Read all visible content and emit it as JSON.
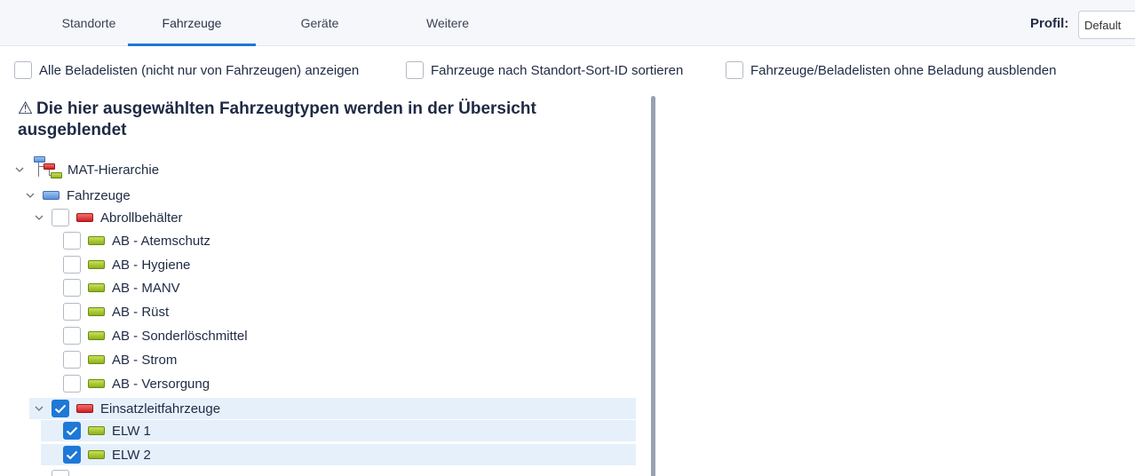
{
  "tabs": [
    {
      "label": "Standorte",
      "active": false
    },
    {
      "label": "Fahrzeuge",
      "active": true
    },
    {
      "label": "Geräte",
      "active": false
    },
    {
      "label": "Weitere",
      "active": false
    }
  ],
  "profile": {
    "label": "Profil:",
    "value": "Default"
  },
  "options": [
    {
      "label": "Alle Beladelisten (nicht nur von Fahrzeugen) anzeigen",
      "checked": false
    },
    {
      "label": "Fahrzeuge nach Standort-Sort-ID sortieren",
      "checked": false
    },
    {
      "label": "Fahrzeuge/Beladelisten ohne Beladung ausblenden",
      "checked": false
    }
  ],
  "heading": {
    "icon": "⚠",
    "text": "Die hier ausgewählten Fahrzeugtypen werden in der Übersicht ausgeblendet"
  },
  "tree": {
    "root": {
      "label": "MAT-Hierarchie",
      "icon": "hierarchy-icon"
    },
    "group": {
      "label": "Fahrzeuge",
      "icon": "blue-folder-icon"
    },
    "items": [
      {
        "label": "Abrollbehälter",
        "level": 2,
        "checked": false,
        "color": "red",
        "expandable": true,
        "selected": false
      },
      {
        "label": "AB - Atemschutz",
        "level": 3,
        "checked": false,
        "color": "green",
        "expandable": false,
        "selected": false
      },
      {
        "label": "AB - Hygiene",
        "level": 3,
        "checked": false,
        "color": "green",
        "expandable": false,
        "selected": false
      },
      {
        "label": "AB - MANV",
        "level": 3,
        "checked": false,
        "color": "green",
        "expandable": false,
        "selected": false
      },
      {
        "label": "AB - Rüst",
        "level": 3,
        "checked": false,
        "color": "green",
        "expandable": false,
        "selected": false
      },
      {
        "label": "AB - Sonderlöschmittel",
        "level": 3,
        "checked": false,
        "color": "green",
        "expandable": false,
        "selected": false
      },
      {
        "label": "AB - Strom",
        "level": 3,
        "checked": false,
        "color": "green",
        "expandable": false,
        "selected": false
      },
      {
        "label": "AB - Versorgung",
        "level": 3,
        "checked": false,
        "color": "green",
        "expandable": false,
        "selected": false
      },
      {
        "label": "Einsatzleitfahrzeuge",
        "level": 2,
        "checked": true,
        "color": "red",
        "expandable": true,
        "selected": true
      },
      {
        "label": "ELW 1",
        "level": 3,
        "checked": true,
        "color": "green",
        "expandable": false,
        "selected": true
      },
      {
        "label": "ELW 2",
        "level": 3,
        "checked": true,
        "color": "green",
        "expandable": false,
        "selected": true
      }
    ]
  },
  "colors": {
    "accent": "#1e78d6",
    "selection": "#e6f0fb",
    "text": "#1f2a44"
  }
}
